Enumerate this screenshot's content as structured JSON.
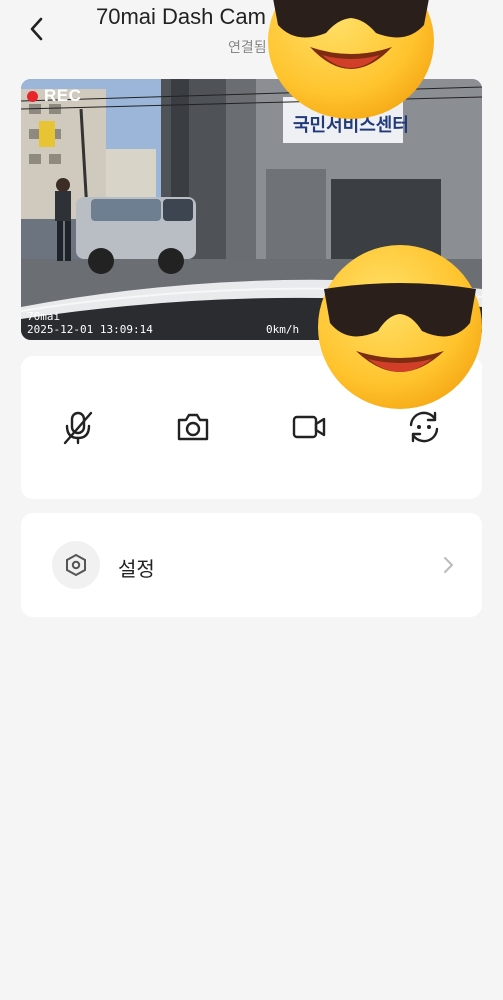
{
  "header": {
    "title": "70mai Dash Cam",
    "subtitle": "연결됨"
  },
  "video": {
    "rec_label": "REC",
    "brand": "70mai",
    "timestamp": "2025-12-01 13:09:14",
    "speed": "0km/h",
    "storefront_sign": "국민서비스센터",
    "rec_color": "#e7262c"
  },
  "controls": {
    "buttons": [
      {
        "name": "mute-mic",
        "icon": "mic-off-icon"
      },
      {
        "name": "capture-photo",
        "icon": "camera-icon"
      },
      {
        "name": "record-video",
        "icon": "video-camera-icon"
      },
      {
        "name": "switch-camera",
        "icon": "switch-camera-icon"
      }
    ]
  },
  "settings": {
    "label": "설정",
    "icon": "hexagon-settings-icon"
  },
  "colors": {
    "background": "#f5f5f5",
    "card": "#ffffff",
    "text": "#222222",
    "muted": "#888888"
  }
}
